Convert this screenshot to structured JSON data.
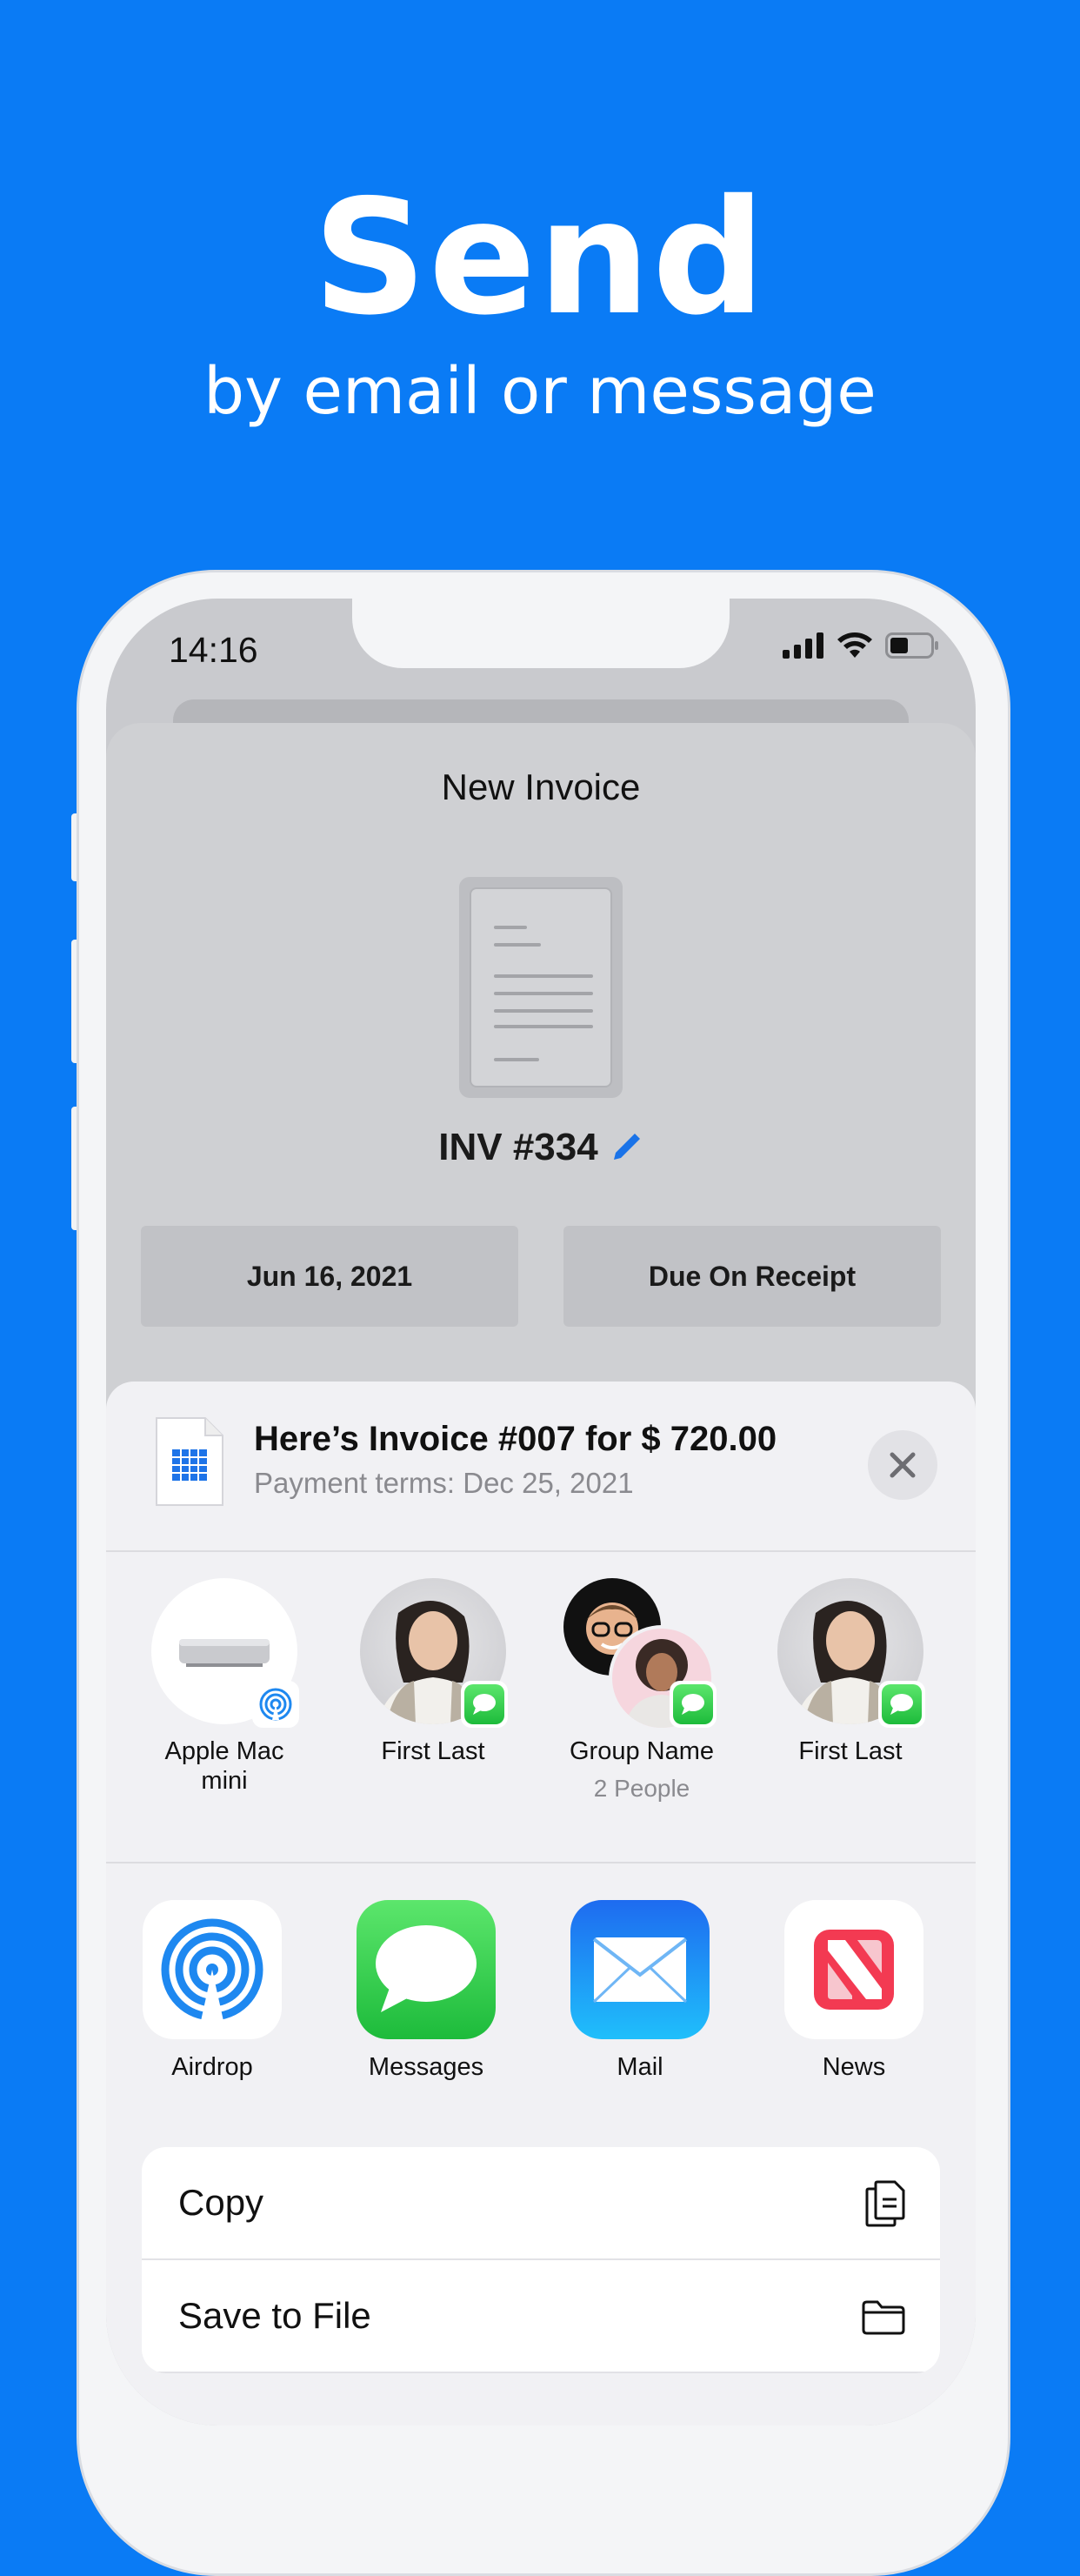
{
  "hero": {
    "title": "Send",
    "subtitle": "by email or message"
  },
  "status_bar": {
    "time": "14:16"
  },
  "invoice": {
    "title": "New Invoice",
    "number": "INV #334",
    "date": "Jun 16, 2021",
    "terms": "Due On Receipt"
  },
  "share_sheet": {
    "title": "Here’s Invoice #007 for $ 720.00",
    "subtitle": "Payment terms: Dec 25, 2021",
    "contacts": [
      {
        "name": "Apple Mac\nmini",
        "badge": "airdrop-icon"
      },
      {
        "name": "First Last",
        "badge": "messages-icon"
      },
      {
        "name": "Group Name",
        "meta": "2 People",
        "badge": "messages-icon"
      },
      {
        "name": "First Last",
        "badge": "messages-icon"
      }
    ],
    "apps": [
      {
        "label": "Airdrop",
        "icon": "airdrop-icon"
      },
      {
        "label": "Messages",
        "icon": "messages-icon"
      },
      {
        "label": "Mail",
        "icon": "mail-icon"
      },
      {
        "label": "News",
        "icon": "news-icon"
      }
    ],
    "actions": [
      {
        "label": "Copy",
        "icon": "copy-icon"
      },
      {
        "label": "Save to File",
        "icon": "folder-icon"
      }
    ]
  },
  "colors": {
    "background": "#0A7BF5",
    "accent": "#1A73E8",
    "messages_green": "#2FCB4A",
    "news_red": "#F33A52"
  }
}
